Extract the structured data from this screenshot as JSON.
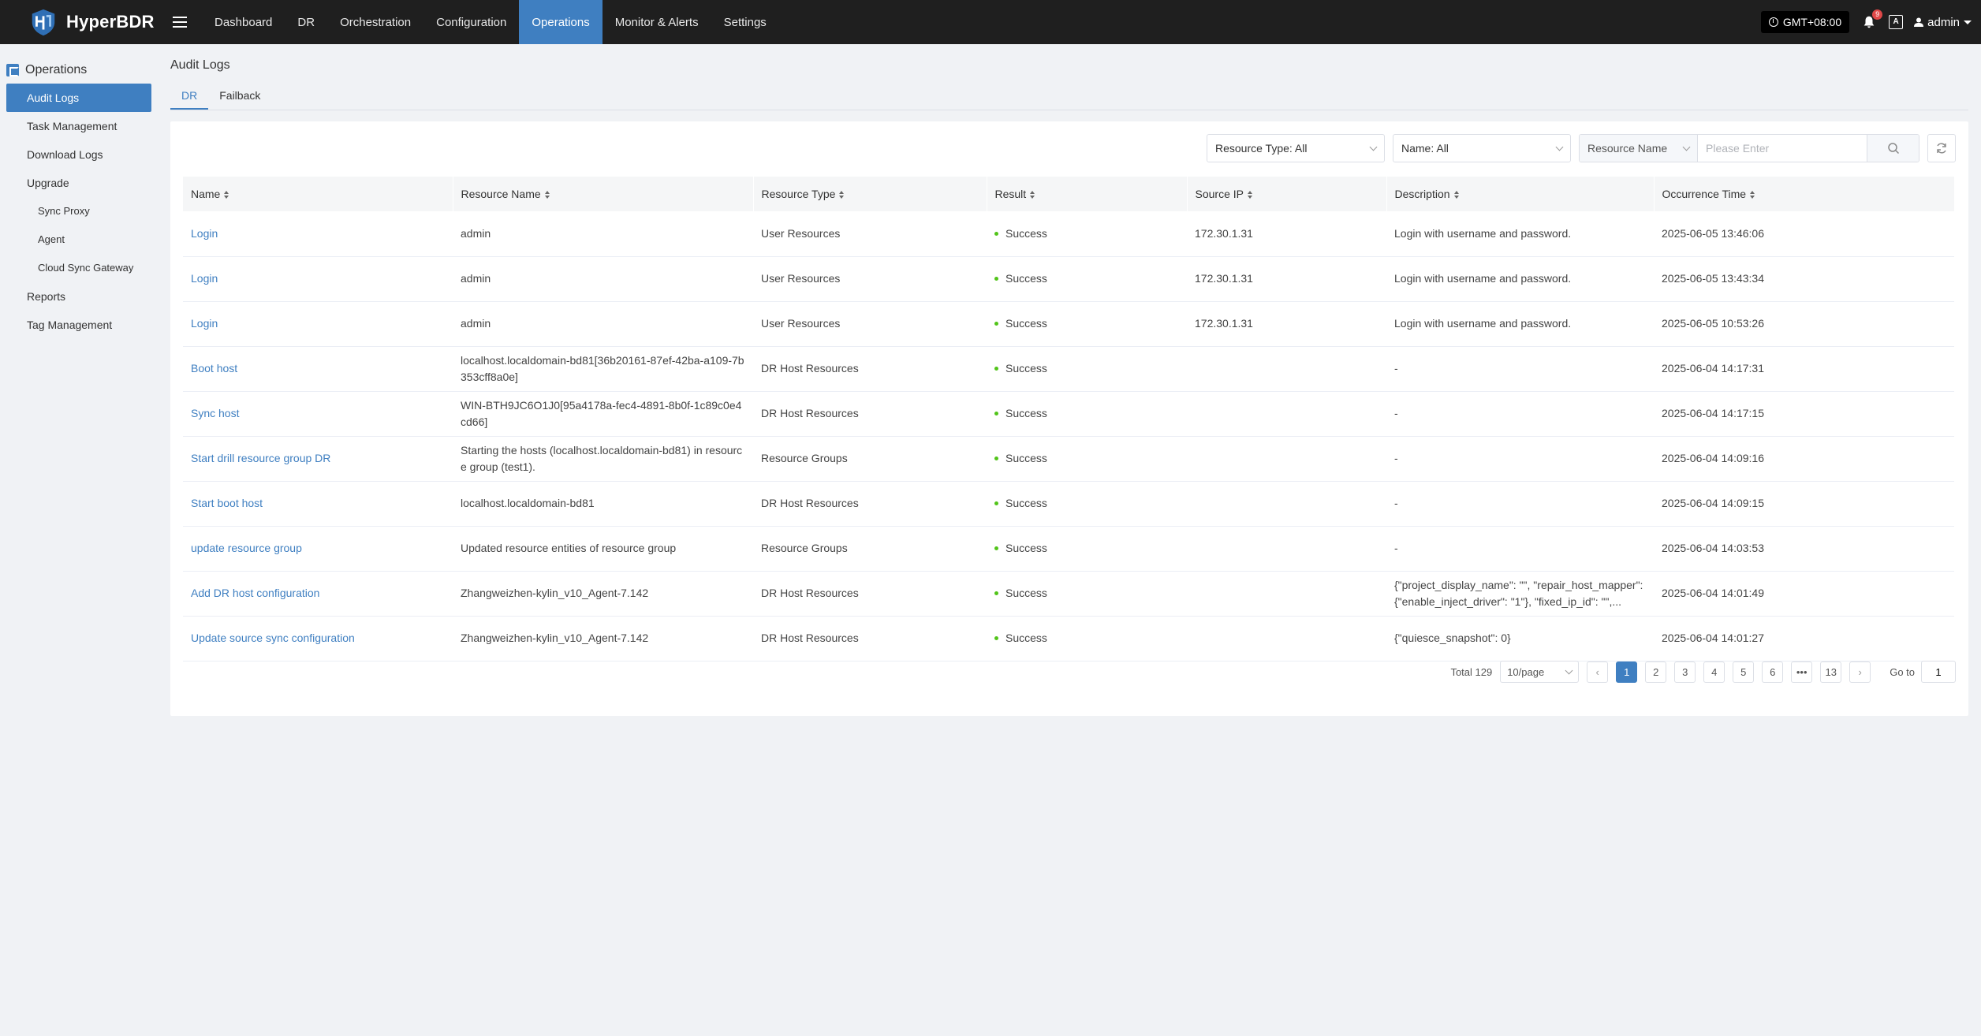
{
  "app": {
    "name": "HyperBDR",
    "timezone": "GMT+08:00",
    "notification_count": "9",
    "lang_icon": "A",
    "user": "admin"
  },
  "nav": [
    "Dashboard",
    "DR",
    "Orchestration",
    "Configuration",
    "Operations",
    "Monitor & Alerts",
    "Settings"
  ],
  "sidebar": {
    "title": "Operations",
    "items": [
      {
        "label": "Audit Logs",
        "active": true
      },
      {
        "label": "Task Management"
      },
      {
        "label": "Download Logs"
      },
      {
        "label": "Upgrade"
      },
      {
        "label": "Sync Proxy",
        "sub": true
      },
      {
        "label": "Agent",
        "sub": true
      },
      {
        "label": "Cloud Sync Gateway",
        "sub": true
      },
      {
        "label": "Reports"
      },
      {
        "label": "Tag Management"
      }
    ]
  },
  "page": {
    "title": "Audit Logs",
    "tabs": [
      "DR",
      "Failback"
    ]
  },
  "filters": {
    "resource_type": "Resource Type: All",
    "name": "Name: All",
    "search_field": "Resource Name",
    "search_placeholder": "Please Enter"
  },
  "table": {
    "columns": [
      "Name",
      "Resource Name",
      "Resource Type",
      "Result",
      "Source IP",
      "Description",
      "Occurrence Time"
    ],
    "rows": [
      [
        "Login",
        "admin",
        "User Resources",
        "Success",
        "172.30.1.31",
        "Login with username and password.",
        "2025-06-05 13:46:06"
      ],
      [
        "Login",
        "admin",
        "User Resources",
        "Success",
        "172.30.1.31",
        "Login with username and password.",
        "2025-06-05 13:43:34"
      ],
      [
        "Login",
        "admin",
        "User Resources",
        "Success",
        "172.30.1.31",
        "Login with username and password.",
        "2025-06-05 10:53:26"
      ],
      [
        "Boot host",
        "localhost.localdomain-bd81[36b20161-87ef-42ba-a109-7b353cff8a0e]",
        "DR Host Resources",
        "Success",
        "",
        "-",
        "2025-06-04 14:17:31"
      ],
      [
        "Sync host",
        "WIN-BTH9JC6O1J0[95a4178a-fec4-4891-8b0f-1c89c0e4cd66]",
        "DR Host Resources",
        "Success",
        "",
        "-",
        "2025-06-04 14:17:15"
      ],
      [
        "Start drill resource group DR",
        "Starting the hosts (localhost.localdomain-bd81) in resource group (test1).",
        "Resource Groups",
        "Success",
        "",
        "-",
        "2025-06-04 14:09:16"
      ],
      [
        "Start boot host",
        "localhost.localdomain-bd81",
        "DR Host Resources",
        "Success",
        "",
        "-",
        "2025-06-04 14:09:15"
      ],
      [
        "update resource group",
        "Updated resource entities of resource group",
        "Resource Groups",
        "Success",
        "",
        "-",
        "2025-06-04 14:03:53"
      ],
      [
        "Add DR host configuration",
        "Zhangweizhen-kylin_v10_Agent-7.142",
        "DR Host Resources",
        "Success",
        "",
        "{\"project_display_name\": \"\", \"repair_host_mapper\": {\"enable_inject_driver\": \"1\"}, \"fixed_ip_id\": \"\",...",
        "2025-06-04 14:01:49"
      ],
      [
        "Update source sync configuration",
        "Zhangweizhen-kylin_v10_Agent-7.142",
        "DR Host Resources",
        "Success",
        "",
        "{\"quiesce_snapshot\": 0}",
        "2025-06-04 14:01:27"
      ]
    ]
  },
  "pagination": {
    "total": "Total 129",
    "page_size": "10/page",
    "pages": [
      "1",
      "2",
      "3",
      "4",
      "5",
      "6",
      "•••",
      "13"
    ],
    "current": "1",
    "goto_label": "Go to",
    "goto_value": "1"
  },
  "colors": {
    "accent": "#3f7fc1",
    "topbar": "#1f1f1f",
    "success": "#52c41a"
  }
}
